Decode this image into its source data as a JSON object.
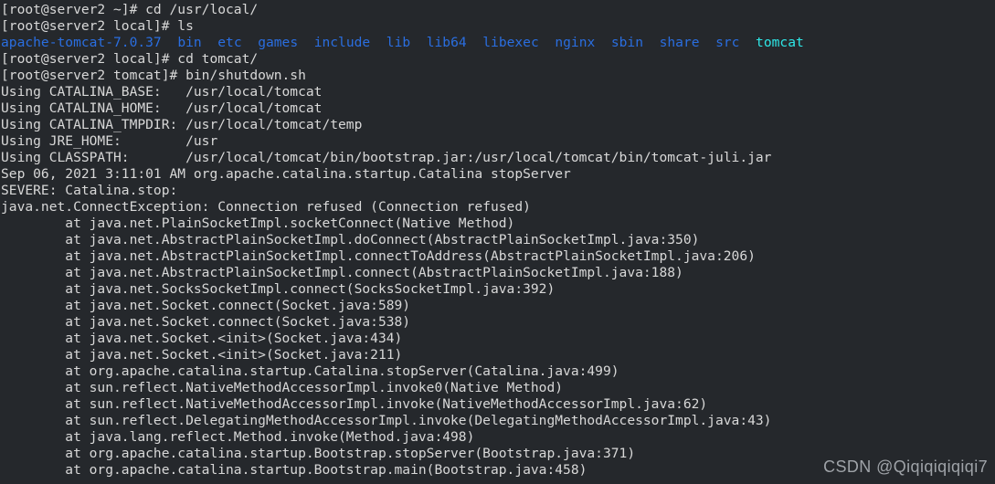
{
  "terminal": {
    "background_color": "#25282c",
    "default_text_color": "#d8d8d8",
    "directory_color": "#2a6ee0",
    "symlink_color": "#2ee6e6",
    "lines": [
      {
        "segments": [
          {
            "text": "[root@server2 ~]# cd /usr/local/",
            "color": "default"
          }
        ]
      },
      {
        "segments": [
          {
            "text": "[root@server2 local]# ls",
            "color": "default"
          }
        ]
      },
      {
        "segments": [
          {
            "text": "apache-tomcat-7.0.37",
            "color": "dir"
          },
          {
            "text": "  ",
            "color": "default"
          },
          {
            "text": "bin",
            "color": "dir"
          },
          {
            "text": "  ",
            "color": "default"
          },
          {
            "text": "etc",
            "color": "dir"
          },
          {
            "text": "  ",
            "color": "default"
          },
          {
            "text": "games",
            "color": "dir"
          },
          {
            "text": "  ",
            "color": "default"
          },
          {
            "text": "include",
            "color": "dir"
          },
          {
            "text": "  ",
            "color": "default"
          },
          {
            "text": "lib",
            "color": "dir"
          },
          {
            "text": "  ",
            "color": "default"
          },
          {
            "text": "lib64",
            "color": "dir"
          },
          {
            "text": "  ",
            "color": "default"
          },
          {
            "text": "libexec",
            "color": "dir"
          },
          {
            "text": "  ",
            "color": "default"
          },
          {
            "text": "nginx",
            "color": "dir"
          },
          {
            "text": "  ",
            "color": "default"
          },
          {
            "text": "sbin",
            "color": "dir"
          },
          {
            "text": "  ",
            "color": "default"
          },
          {
            "text": "share",
            "color": "dir"
          },
          {
            "text": "  ",
            "color": "default"
          },
          {
            "text": "src",
            "color": "dir"
          },
          {
            "text": "  ",
            "color": "default"
          },
          {
            "text": "tomcat",
            "color": "link"
          }
        ]
      },
      {
        "segments": [
          {
            "text": "[root@server2 local]# cd tomcat/",
            "color": "default"
          }
        ]
      },
      {
        "segments": [
          {
            "text": "[root@server2 tomcat]# bin/shutdown.sh",
            "color": "default"
          }
        ]
      },
      {
        "segments": [
          {
            "text": "Using CATALINA_BASE:   /usr/local/tomcat",
            "color": "default"
          }
        ]
      },
      {
        "segments": [
          {
            "text": "Using CATALINA_HOME:   /usr/local/tomcat",
            "color": "default"
          }
        ]
      },
      {
        "segments": [
          {
            "text": "Using CATALINA_TMPDIR: /usr/local/tomcat/temp",
            "color": "default"
          }
        ]
      },
      {
        "segments": [
          {
            "text": "Using JRE_HOME:        /usr",
            "color": "default"
          }
        ]
      },
      {
        "segments": [
          {
            "text": "Using CLASSPATH:       /usr/local/tomcat/bin/bootstrap.jar:/usr/local/tomcat/bin/tomcat-juli.jar",
            "color": "default"
          }
        ]
      },
      {
        "segments": [
          {
            "text": "Sep 06, 2021 3:11:01 AM org.apache.catalina.startup.Catalina stopServer",
            "color": "default"
          }
        ]
      },
      {
        "segments": [
          {
            "text": "SEVERE: Catalina.stop:",
            "color": "default"
          }
        ]
      },
      {
        "segments": [
          {
            "text": "java.net.ConnectException: Connection refused (Connection refused)",
            "color": "default"
          }
        ]
      },
      {
        "segments": [
          {
            "text": "        at java.net.PlainSocketImpl.socketConnect(Native Method)",
            "color": "default"
          }
        ]
      },
      {
        "segments": [
          {
            "text": "        at java.net.AbstractPlainSocketImpl.doConnect(AbstractPlainSocketImpl.java:350)",
            "color": "default"
          }
        ]
      },
      {
        "segments": [
          {
            "text": "        at java.net.AbstractPlainSocketImpl.connectToAddress(AbstractPlainSocketImpl.java:206)",
            "color": "default"
          }
        ]
      },
      {
        "segments": [
          {
            "text": "        at java.net.AbstractPlainSocketImpl.connect(AbstractPlainSocketImpl.java:188)",
            "color": "default"
          }
        ]
      },
      {
        "segments": [
          {
            "text": "        at java.net.SocksSocketImpl.connect(SocksSocketImpl.java:392)",
            "color": "default"
          }
        ]
      },
      {
        "segments": [
          {
            "text": "        at java.net.Socket.connect(Socket.java:589)",
            "color": "default"
          }
        ]
      },
      {
        "segments": [
          {
            "text": "        at java.net.Socket.connect(Socket.java:538)",
            "color": "default"
          }
        ]
      },
      {
        "segments": [
          {
            "text": "        at java.net.Socket.<init>(Socket.java:434)",
            "color": "default"
          }
        ]
      },
      {
        "segments": [
          {
            "text": "        at java.net.Socket.<init>(Socket.java:211)",
            "color": "default"
          }
        ]
      },
      {
        "segments": [
          {
            "text": "        at org.apache.catalina.startup.Catalina.stopServer(Catalina.java:499)",
            "color": "default"
          }
        ]
      },
      {
        "segments": [
          {
            "text": "        at sun.reflect.NativeMethodAccessorImpl.invoke0(Native Method)",
            "color": "default"
          }
        ]
      },
      {
        "segments": [
          {
            "text": "        at sun.reflect.NativeMethodAccessorImpl.invoke(NativeMethodAccessorImpl.java:62)",
            "color": "default"
          }
        ]
      },
      {
        "segments": [
          {
            "text": "        at sun.reflect.DelegatingMethodAccessorImpl.invoke(DelegatingMethodAccessorImpl.java:43)",
            "color": "default"
          }
        ]
      },
      {
        "segments": [
          {
            "text": "        at java.lang.reflect.Method.invoke(Method.java:498)",
            "color": "default"
          }
        ]
      },
      {
        "segments": [
          {
            "text": "        at org.apache.catalina.startup.Bootstrap.stopServer(Bootstrap.java:371)",
            "color": "default"
          }
        ]
      },
      {
        "segments": [
          {
            "text": "        at org.apache.catalina.startup.Bootstrap.main(Bootstrap.java:458)",
            "color": "default"
          }
        ]
      }
    ]
  },
  "watermark": {
    "text": "CSDN @Qiqiqiqiqiqi7"
  }
}
